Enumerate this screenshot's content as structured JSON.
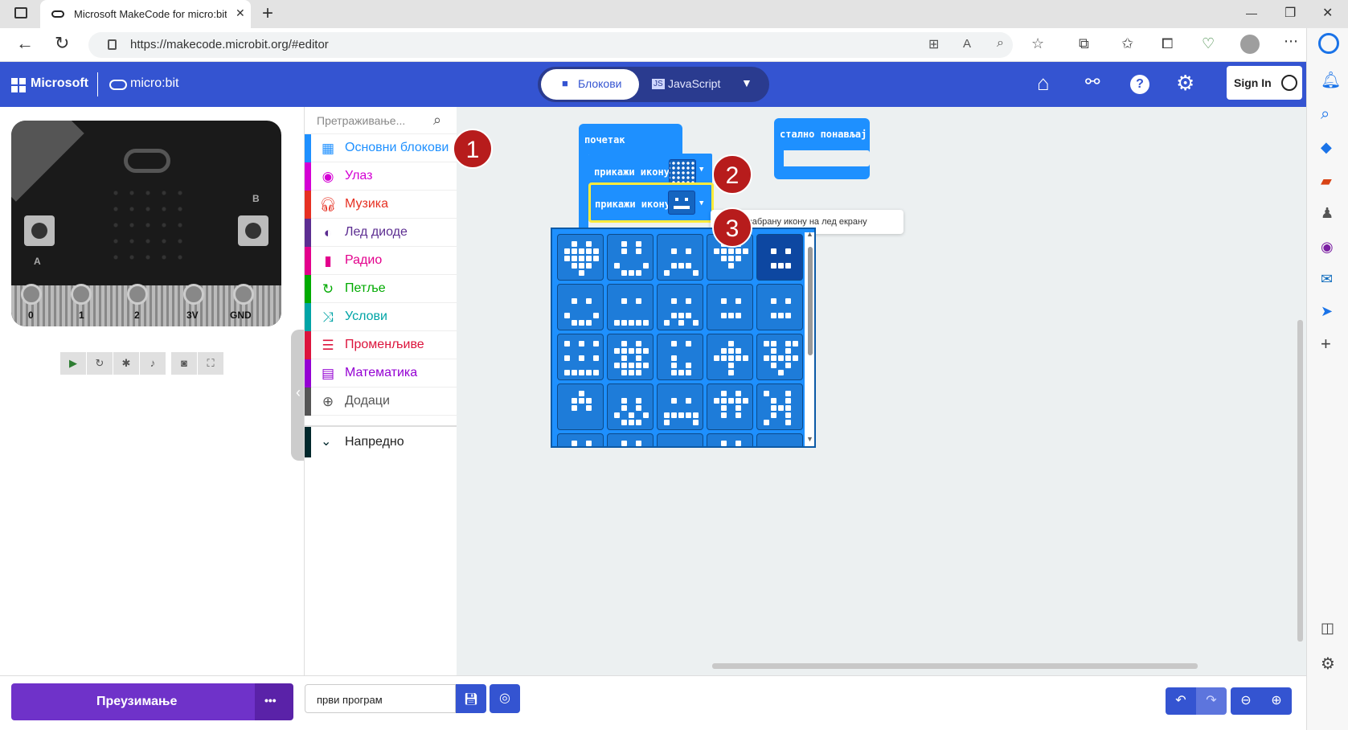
{
  "browser": {
    "tab_title": "Microsoft MakeCode for micro:bit",
    "url": "https://makecode.microbit.org/#editor",
    "new_tab": "+",
    "win_min": "—",
    "win_max": "❐",
    "win_close": "✕"
  },
  "app": {
    "ms_brand": "Microsoft",
    "mb_brand": "micro:bit",
    "tab_blocks": "Блокови",
    "tab_js": "JavaScript",
    "sign_in": "Sign In"
  },
  "simulator": {
    "pins": [
      "0",
      "1",
      "2",
      "3V",
      "GND"
    ],
    "label_a": "A",
    "label_b": "B"
  },
  "toolbox": {
    "search_placeholder": "Претраживање...",
    "categories": [
      {
        "label": "Основни блокови",
        "color": "#1e90ff",
        "icon": "grid-icon"
      },
      {
        "label": "Улаз",
        "color": "#d400d4",
        "icon": "circle-icon"
      },
      {
        "label": "Музика",
        "color": "#e63022",
        "icon": "headphones-icon"
      },
      {
        "label": "Лед диоде",
        "color": "#5c2d91",
        "icon": "toggle-icon"
      },
      {
        "label": "Радио",
        "color": "#e3008c",
        "icon": "signal-icon"
      },
      {
        "label": "Петље",
        "color": "#00aa00",
        "icon": "refresh-icon"
      },
      {
        "label": "Услови",
        "color": "#00a4a6",
        "icon": "shuffle-icon"
      },
      {
        "label": "Променљиве",
        "color": "#dc143c",
        "icon": "list-icon"
      },
      {
        "label": "Математика",
        "color": "#9400d3",
        "icon": "calculator-icon"
      },
      {
        "label": "Додаци",
        "color": "#555555",
        "icon": "plus-circle-icon"
      }
    ],
    "advanced": "Напредно"
  },
  "workspace": {
    "on_start": "почетак",
    "forever": "стално понављај",
    "show_icon_1": "прикажи икону",
    "show_icon_2": "прикажи икону",
    "tooltip": "Цртај изабрану икону на лед екрану"
  },
  "callouts": [
    "1",
    "2",
    "3"
  ],
  "bottom": {
    "download": "Преузимање",
    "more": "•••",
    "project_name": "први програм"
  }
}
